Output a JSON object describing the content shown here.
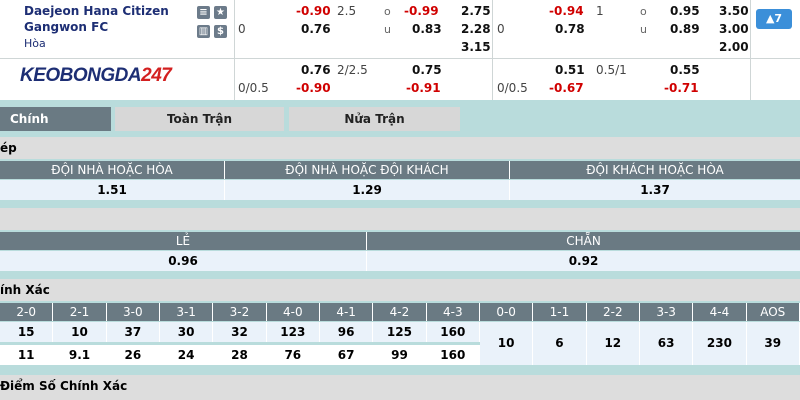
{
  "match": {
    "home_team": "Daejeon Hana Citizen",
    "away_team": "Gangwon FC",
    "draw_label": "Hòa"
  },
  "odds_full": {
    "handicap_line": "0",
    "handicap_home": "-0.90",
    "handicap_away": "0.76",
    "ou_line": "2.5",
    "ou_over_label": "o",
    "ou_under_label": "u",
    "ou_over": "-0.99",
    "ou_under": "0.83",
    "x12_home": "2.75",
    "x12_away": "2.28",
    "x12_draw": "3.15"
  },
  "odds_half": {
    "handicap_line": "0",
    "handicap_home": "-0.94",
    "handicap_away": "0.78",
    "ou_line": "1",
    "ou_over": "0.95",
    "ou_under": "0.89",
    "x12_home": "3.50",
    "x12_away": "3.00",
    "x12_draw": "2.00"
  },
  "odds_row2_full": {
    "handicap_line": "0/0.5",
    "home": "0.76",
    "away": "-0.90",
    "ou_line": "2/2.5",
    "over": "0.75",
    "under": "-0.91"
  },
  "odds_row2_half": {
    "handicap_line": "0/0.5",
    "home": "0.51",
    "away": "-0.67",
    "ou_line": "0.5/1",
    "over": "0.55",
    "under": "-0.71"
  },
  "logo": {
    "part1": "KEOBONGDA",
    "part2": "247"
  },
  "more_button": "▲7",
  "icons": {
    "stats": "H2H",
    "star": "★",
    "chart": "▥",
    "money": "$"
  },
  "tabs": [
    "Chính",
    "Toàn Trận",
    "Nửa Trận"
  ],
  "double_chance": {
    "title": "ép",
    "headers": [
      "ĐỘI NHÀ HOẶC HÒA",
      "ĐỘI NHÀ HOẶC ĐỘI KHÁCH",
      "ĐỘI KHÁCH HOẶC HÒA"
    ],
    "values": [
      "1.51",
      "1.29",
      "1.37"
    ]
  },
  "odd_even": {
    "title": "",
    "headers": [
      "LẺ",
      "CHẴN"
    ],
    "values": [
      "0.96",
      "0.92"
    ]
  },
  "correct_score": {
    "title": "ính Xác",
    "headers": [
      "2-0",
      "2-1",
      "3-0",
      "3-1",
      "3-2",
      "4-0",
      "4-1",
      "4-2",
      "4-3",
      "0-0",
      "1-1",
      "2-2",
      "3-3",
      "4-4",
      "AOS"
    ],
    "home_row": [
      "15",
      "10",
      "37",
      "30",
      "32",
      "123",
      "96",
      "125",
      "160"
    ],
    "away_row": [
      "11",
      "9.1",
      "26",
      "24",
      "28",
      "76",
      "67",
      "99",
      "160"
    ],
    "draw_row": [
      "10",
      "6",
      "12",
      "63",
      "230",
      "39"
    ]
  },
  "next_section_title": "Điểm Số Chính Xác"
}
